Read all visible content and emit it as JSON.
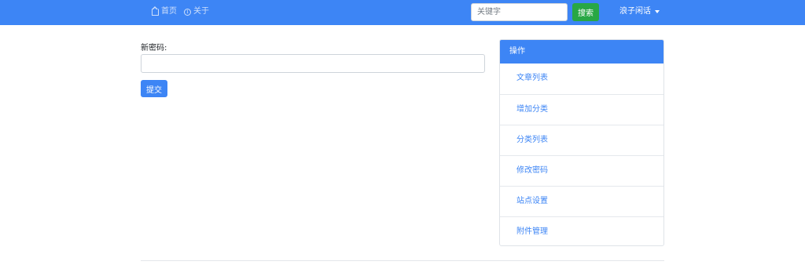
{
  "navbar": {
    "links": [
      {
        "label": "首页",
        "icon": "home-icon"
      },
      {
        "label": "关于",
        "icon": "info-icon"
      }
    ],
    "search": {
      "placeholder": "关键字",
      "value": "",
      "button_label": "搜索"
    },
    "user_menu_label": "浪子闲话"
  },
  "form": {
    "new_password_label": "新密码:",
    "new_password_value": "",
    "submit_label": "提交"
  },
  "sidebar": {
    "header": "操作",
    "items": [
      {
        "label": "文章列表"
      },
      {
        "label": "增加分类"
      },
      {
        "label": "分类列表"
      },
      {
        "label": "修改密码"
      },
      {
        "label": "站点设置"
      },
      {
        "label": "附件管理"
      }
    ]
  },
  "colors": {
    "primary": "#3d85f5",
    "success": "#28a745",
    "nav_link": "#cfe0fb"
  }
}
